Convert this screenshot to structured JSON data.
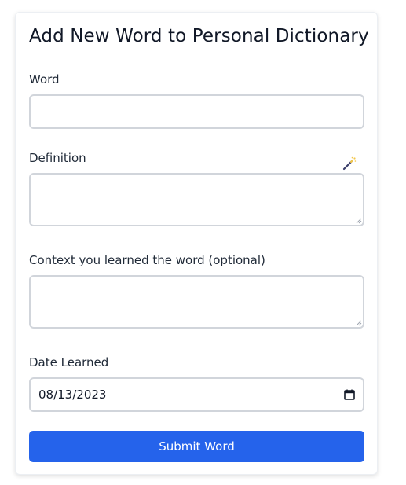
{
  "form": {
    "title": "Add New Word to Personal Dictionary",
    "word": {
      "label": "Word",
      "value": "",
      "placeholder": ""
    },
    "definition": {
      "label": "Definition",
      "value": "",
      "placeholder": "",
      "assist_icon": "magic-wand-icon"
    },
    "context": {
      "label": "Context you learned the word (optional)",
      "value": "",
      "placeholder": ""
    },
    "date_learned": {
      "label": "Date Learned",
      "value": "08/13/2023",
      "icon": "calendar-icon"
    },
    "submit_label": "Submit Word"
  },
  "colors": {
    "accent": "#2563eb",
    "border": "#d1d5db",
    "text": "#1f2937"
  }
}
